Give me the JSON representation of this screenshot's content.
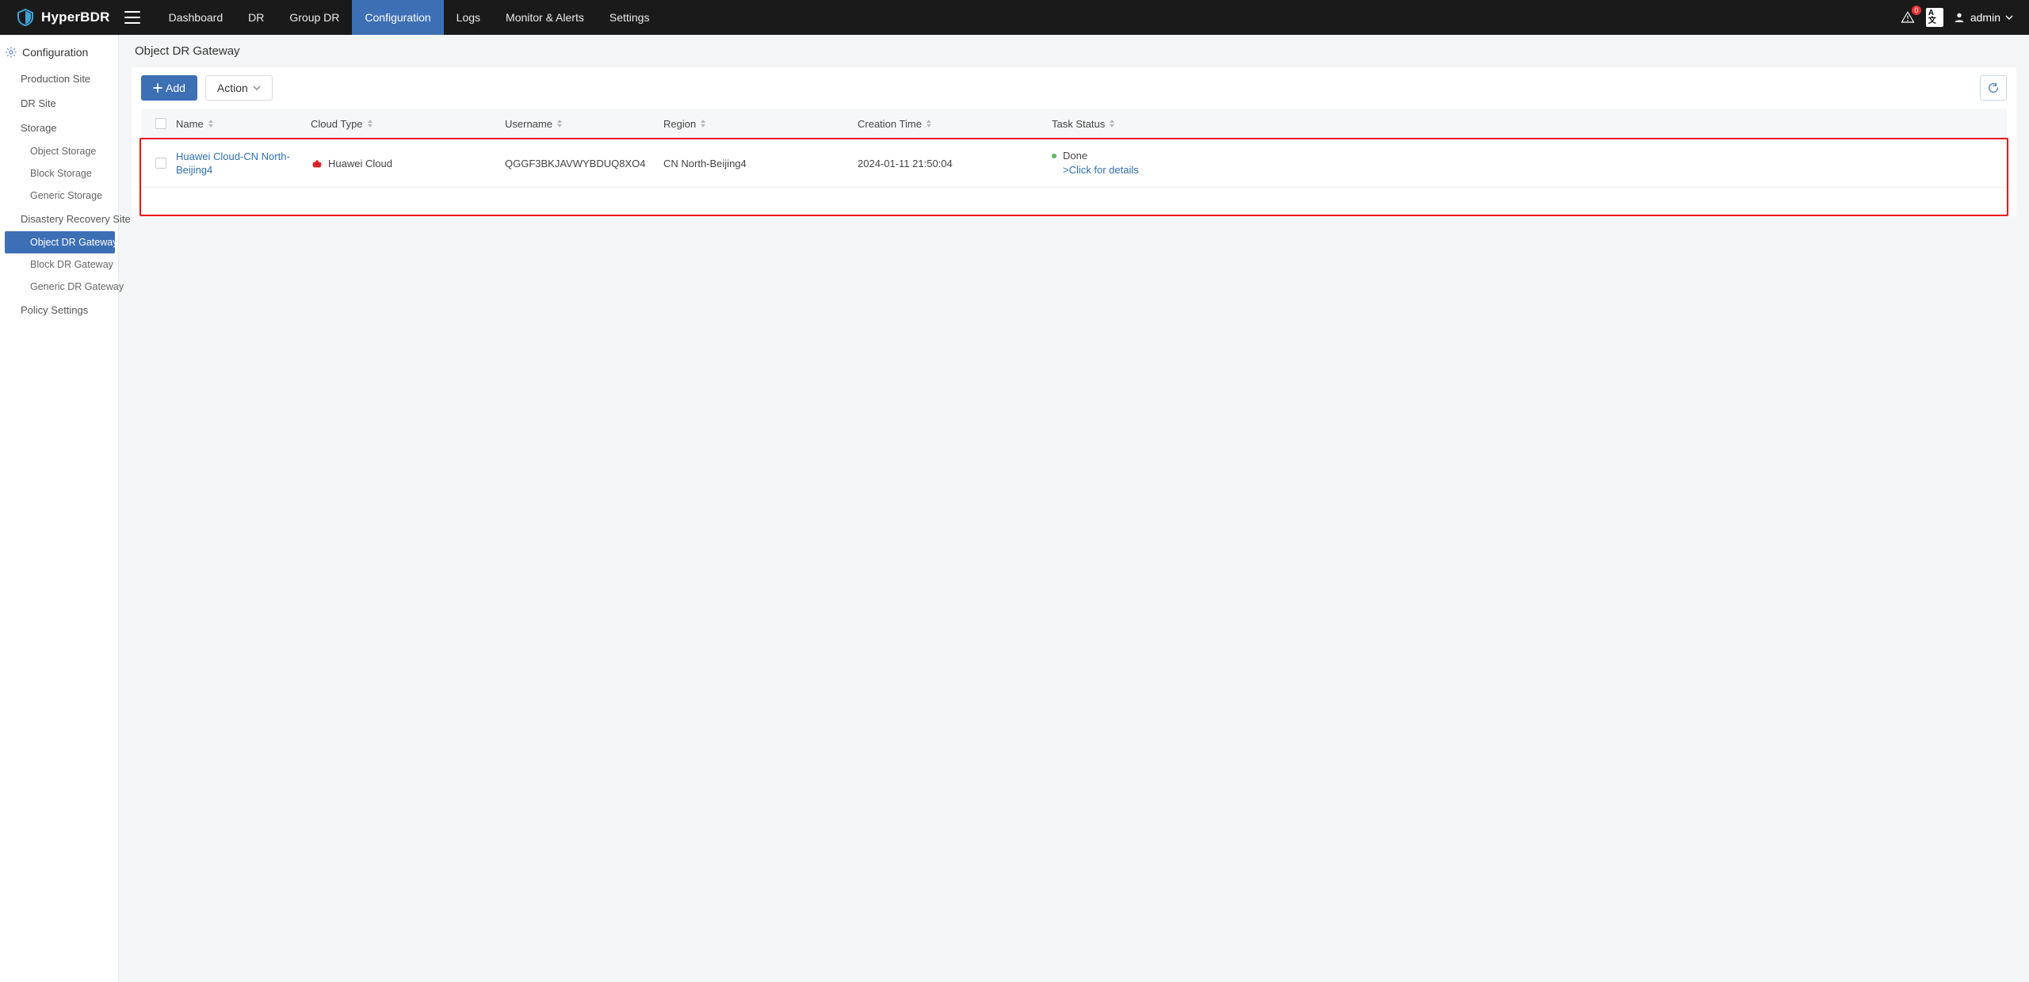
{
  "app": {
    "name": "HyperBDR"
  },
  "topnav": {
    "items": [
      {
        "label": "Dashboard"
      },
      {
        "label": "DR"
      },
      {
        "label": "Group DR"
      },
      {
        "label": "Configuration",
        "active": true
      },
      {
        "label": "Logs"
      },
      {
        "label": "Monitor & Alerts"
      },
      {
        "label": "Settings"
      }
    ]
  },
  "topbar": {
    "alert_badge": "0",
    "lang_code": "A文",
    "user_name": "admin"
  },
  "sidebar": {
    "section_title": "Configuration",
    "items": [
      {
        "label": "Production Site",
        "kind": "item"
      },
      {
        "label": "DR Site",
        "kind": "item"
      },
      {
        "label": "Storage",
        "kind": "item"
      },
      {
        "label": "Object Storage",
        "kind": "sub"
      },
      {
        "label": "Block Storage",
        "kind": "sub"
      },
      {
        "label": "Generic Storage",
        "kind": "sub"
      },
      {
        "label": "Disastery Recovery Site",
        "kind": "item"
      },
      {
        "label": "Object DR Gateway",
        "kind": "sub",
        "active": true
      },
      {
        "label": "Block DR Gateway",
        "kind": "sub"
      },
      {
        "label": "Generic DR Gateway",
        "kind": "sub"
      },
      {
        "label": "Policy Settings",
        "kind": "item"
      }
    ]
  },
  "page": {
    "title": "Object DR Gateway",
    "add_button": "Add",
    "action_button": "Action",
    "columns": {
      "name": "Name",
      "cloud_type": "Cloud Type",
      "username": "Username",
      "region": "Region",
      "creation_time": "Creation Time",
      "task_status": "Task Status"
    },
    "rows": [
      {
        "name": "Huawei Cloud-CN North-Beijing4",
        "cloud_type": "Huawei Cloud",
        "username": "QGGF3BKJAVWYBDUQ8XO4",
        "region": "CN North-Beijing4",
        "creation_time": "2024-01-11 21:50:04",
        "status_text": "Done",
        "details_text": ">Click for details"
      }
    ]
  }
}
